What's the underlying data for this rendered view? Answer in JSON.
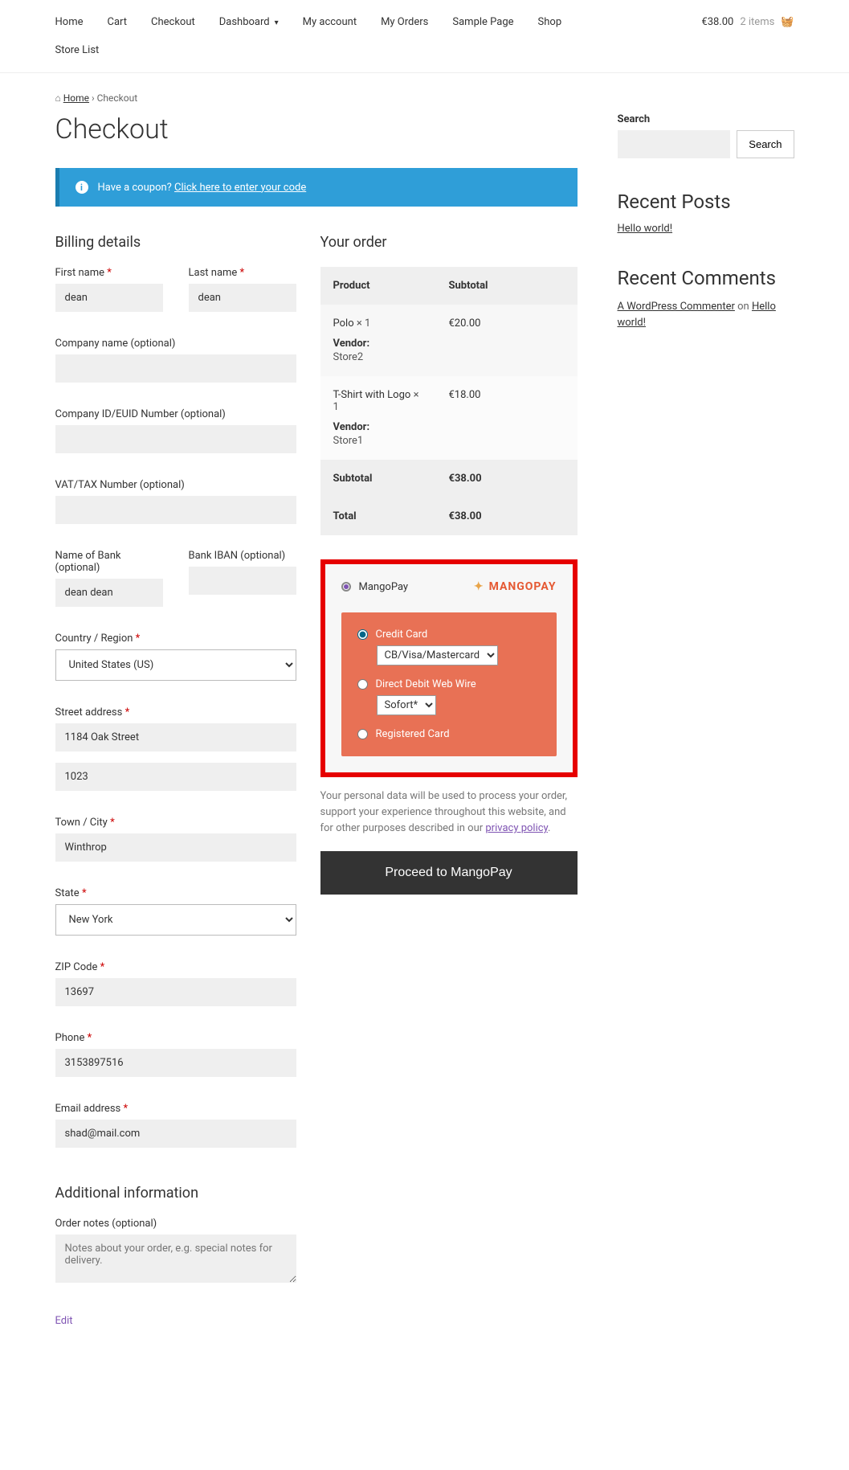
{
  "nav": {
    "links": [
      "Home",
      "Cart",
      "Checkout",
      "Dashboard",
      "My account",
      "My Orders",
      "Sample Page",
      "Shop"
    ],
    "store_list": "Store List",
    "cart_total": "€38.00",
    "cart_items": "2 items"
  },
  "breadcrumb": {
    "home": "Home",
    "current": "Checkout"
  },
  "page_title": "Checkout",
  "coupon": {
    "text": "Have a coupon?",
    "link": "Click here to enter your code"
  },
  "billing": {
    "heading": "Billing details",
    "first_name_label": "First name",
    "first_name": "dean",
    "last_name_label": "Last name",
    "last_name": "dean",
    "company_label": "Company name (optional)",
    "company": "",
    "company_id_label": "Company ID/EUID Number (optional)",
    "company_id": "",
    "vat_label": "VAT/TAX Number (optional)",
    "vat": "",
    "bank_name_label": "Name of Bank (optional)",
    "bank_name": "dean dean",
    "bank_iban_label": "Bank IBAN (optional)",
    "bank_iban": "",
    "country_label": "Country / Region",
    "country": "United States (US)",
    "street_label": "Street address",
    "street1": "1184 Oak Street",
    "street2": "1023",
    "town_label": "Town / City",
    "town": "Winthrop",
    "state_label": "State",
    "state": "New York",
    "zip_label": "ZIP Code",
    "zip": "13697",
    "phone_label": "Phone",
    "phone": "3153897516",
    "email_label": "Email address",
    "email": "shad@mail.com"
  },
  "additional": {
    "heading": "Additional information",
    "notes_label": "Order notes (optional)",
    "notes_placeholder": "Notes about your order, e.g. special notes for delivery."
  },
  "edit_label": "Edit",
  "order": {
    "heading": "Your order",
    "product_th": "Product",
    "subtotal_th": "Subtotal",
    "items": [
      {
        "name": "Polo",
        "qty": "× 1",
        "subtotal": "€20.00",
        "vendor_label": "Vendor:",
        "vendor": "Store2"
      },
      {
        "name": "T-Shirt with Logo",
        "qty": "× 1",
        "subtotal": "€18.00",
        "vendor_label": "Vendor:",
        "vendor": "Store1"
      }
    ],
    "subtotal_label": "Subtotal",
    "subtotal": "€38.00",
    "total_label": "Total",
    "total": "€38.00"
  },
  "payment": {
    "name": "MangoPay",
    "brand": "MANGOPAY",
    "cc_label": "Credit Card",
    "cc_option": "CB/Visa/Mastercard",
    "dd_label": "Direct Debit Web Wire",
    "dd_option": "Sofort*",
    "reg_label": "Registered Card",
    "privacy": "Your personal data will be used to process your order, support your experience throughout this website, and for other purposes described in our ",
    "privacy_link": "privacy policy",
    "proceed": "Proceed to MangoPay"
  },
  "sidebar": {
    "search_label": "Search",
    "search_btn": "Search",
    "recent_posts": "Recent Posts",
    "post1": "Hello world!",
    "recent_comments": "Recent Comments",
    "commenter": "A WordPress Commenter",
    "on": " on ",
    "comment_post": "Hello world!"
  }
}
